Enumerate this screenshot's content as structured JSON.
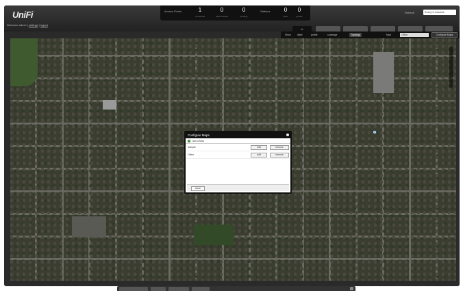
{
  "header": {
    "logo": "UniFi",
    "welcome": "Welcome admin",
    "settings_link": "settings",
    "logout_link": "logout"
  },
  "stats": {
    "access_points_label": "Access Points",
    "access_points": [
      {
        "value": "1",
        "label": "connected"
      },
      {
        "value": "0",
        "label": "disconnected"
      },
      {
        "value": "0",
        "label": "pending"
      }
    ],
    "stations_label": "Stations",
    "stations": [
      {
        "value": "0",
        "label": "users"
      },
      {
        "value": "0",
        "label": "guests"
      }
    ]
  },
  "refresh": {
    "label": "Refresh",
    "selected": "Every 2 minutes"
  },
  "map_toolbar": {
    "buttons": [
      "Show",
      "label",
      "profile",
      "coverage",
      "Topology"
    ],
    "active": "Topology",
    "map_label": "Map",
    "map_select": "Office",
    "configure_button": "Configure Maps"
  },
  "dialog": {
    "title": "Configure Maps",
    "add_label": "Add a Map",
    "maps": [
      {
        "name": "Sample",
        "edit": "edit",
        "remove": "remove"
      },
      {
        "name": "Office",
        "edit": "edit",
        "remove": "remove"
      }
    ],
    "close_label": "close"
  },
  "colors": {
    "header": "#222222",
    "accent": "#4aa3ff",
    "dialog_title": "#111111"
  }
}
